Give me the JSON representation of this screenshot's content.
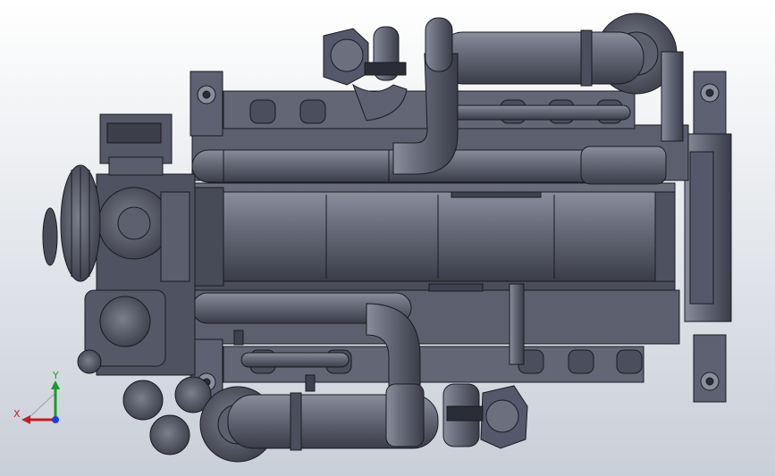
{
  "viewport": {
    "background_top": "#ffffff",
    "background_bottom": "#c9cfd8",
    "model_color": "#5a5d6b",
    "model_dark": "#2b2d36",
    "model_light": "#8a8d9c",
    "model_edge": "#1a1b22"
  },
  "triad": {
    "x_label": "X",
    "y_label": "Y",
    "x_color": "#c0202a",
    "y_color": "#1f9a2a",
    "z_color": "#1f3fd0"
  }
}
